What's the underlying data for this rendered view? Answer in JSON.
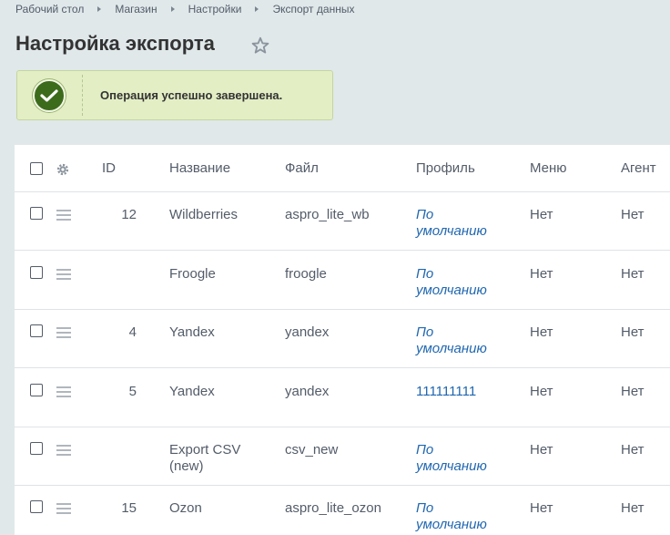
{
  "breadcrumb": [
    "Рабочий стол",
    "Магазин",
    "Настройки",
    "Экспорт данных"
  ],
  "page_title": "Настройка экспорта",
  "alert": {
    "message": "Операция успешно завершена."
  },
  "table": {
    "headers": {
      "id": "ID",
      "name": "Название",
      "file": "Файл",
      "profile": "Профиль",
      "menu": "Меню",
      "agent": "Агент"
    },
    "rows": [
      {
        "id": "12",
        "name": "Wildberries",
        "file": "aspro_lite_wb",
        "profile": "По умолчанию",
        "menu": "Нет",
        "agent": "Нет"
      },
      {
        "id": "",
        "name": "Froogle",
        "file": "froogle",
        "profile": "По умолчанию",
        "menu": "Нет",
        "agent": "Нет"
      },
      {
        "id": "4",
        "name": "Yandex",
        "file": "yandex",
        "profile": "По умолчанию",
        "menu": "Нет",
        "agent": "Нет"
      },
      {
        "id": "5",
        "name": "Yandex",
        "file": "yandex",
        "profile": "111111111",
        "menu": "Нет",
        "agent": "Нет"
      },
      {
        "id": "",
        "name": "Export CSV (new)",
        "file": "csv_new",
        "profile": "По умолчанию",
        "menu": "Нет",
        "agent": "Нет"
      },
      {
        "id": "15",
        "name": "Ozon",
        "file": "aspro_lite_ozon",
        "profile": "По умолчанию",
        "menu": "Нет",
        "agent": "Нет"
      }
    ]
  },
  "colors": {
    "success": "#3d6b1c",
    "link": "#2067b0",
    "alert_bg": "#e3eec5"
  }
}
